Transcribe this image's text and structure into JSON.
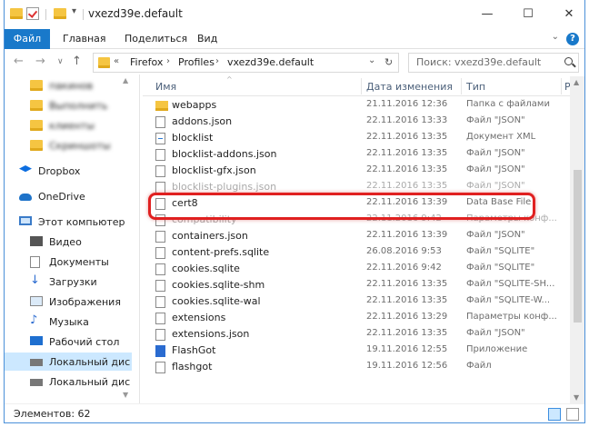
{
  "window": {
    "title": "vxezd39e.default"
  },
  "window_controls": {
    "minimize": "—",
    "maximize": "☐",
    "close": "✕"
  },
  "ribbon": {
    "tabs": [
      "Файл",
      "Главная",
      "Поделиться",
      "Вид"
    ],
    "help": "?"
  },
  "address": {
    "prefix": "«",
    "crumbs": [
      "Firefox",
      "Profiles",
      "vxezd39e.default"
    ],
    "search_placeholder": "Поиск: vxezd39e.default"
  },
  "navpane": {
    "quick_access": [
      "​пакинов",
      "Выполнить",
      "клиенты",
      "Скриншоты"
    ],
    "items": [
      {
        "label": "Dropbox",
        "icon": "dropbox-icon"
      },
      {
        "label": "OneDrive",
        "icon": "onedrive-icon"
      },
      {
        "label": "Этот компьютер",
        "icon": "computer-icon"
      },
      {
        "label": "Видео",
        "icon": "video-icon"
      },
      {
        "label": "Документы",
        "icon": "documents-icon"
      },
      {
        "label": "Загрузки",
        "icon": "downloads-icon"
      },
      {
        "label": "Изображения",
        "icon": "images-icon"
      },
      {
        "label": "Музыка",
        "icon": "music-icon"
      },
      {
        "label": "Рабочий стол",
        "icon": "desktop-icon"
      },
      {
        "label": "Локальный дис",
        "icon": "drive-icon"
      },
      {
        "label": "Локальный дис",
        "icon": "drive-icon"
      }
    ]
  },
  "columns": {
    "name": "Имя",
    "date": "Дата изменения",
    "type": "Тип",
    "size": "Р"
  },
  "files": [
    {
      "name": "webapps",
      "date": "21.11.2016 12:36",
      "type": "Папка с файлами",
      "kind": "folder"
    },
    {
      "name": "addons.json",
      "date": "22.11.2016 13:33",
      "type": "Файл \"JSON\"",
      "kind": "file"
    },
    {
      "name": "blocklist",
      "date": "22.11.2016 13:35",
      "type": "Документ XML",
      "kind": "xml"
    },
    {
      "name": "blocklist-addons.json",
      "date": "22.11.2016 13:35",
      "type": "Файл \"JSON\"",
      "kind": "file"
    },
    {
      "name": "blocklist-gfx.json",
      "date": "22.11.2016 13:35",
      "type": "Файл \"JSON\"",
      "kind": "file"
    },
    {
      "name": "blocklist-plugins.json",
      "date": "22.11.2016 13:35",
      "type": "Файл \"JSON\"",
      "kind": "file",
      "faded": true
    },
    {
      "name": "cert8",
      "date": "22.11.2016 13:39",
      "type": "Data Base File",
      "kind": "file"
    },
    {
      "name": "compatibility",
      "date": "22.11.2016 9:42",
      "type": "Параметры конф...",
      "kind": "file",
      "faded": true
    },
    {
      "name": "containers.json",
      "date": "22.11.2016 13:39",
      "type": "Файл \"JSON\"",
      "kind": "file"
    },
    {
      "name": "content-prefs.sqlite",
      "date": "26.08.2016 9:53",
      "type": "Файл \"SQLITE\"",
      "kind": "file"
    },
    {
      "name": "cookies.sqlite",
      "date": "22.11.2016 9:42",
      "type": "Файл \"SQLITE\"",
      "kind": "file"
    },
    {
      "name": "cookies.sqlite-shm",
      "date": "22.11.2016 13:35",
      "type": "Файл \"SQLITE-SH...",
      "kind": "file"
    },
    {
      "name": "cookies.sqlite-wal",
      "date": "22.11.2016 13:35",
      "type": "Файл \"SQLITE-W...",
      "kind": "file"
    },
    {
      "name": "extensions",
      "date": "22.11.2016 13:29",
      "type": "Параметры конф...",
      "kind": "file"
    },
    {
      "name": "extensions.json",
      "date": "22.11.2016 13:35",
      "type": "Файл \"JSON\"",
      "kind": "file"
    },
    {
      "name": "FlashGot",
      "date": "19.11.2016 12:55",
      "type": "Приложение",
      "kind": "exe"
    },
    {
      "name": "flashgot",
      "date": "19.11.2016 12:56",
      "type": "Файл",
      "kind": "file"
    }
  ],
  "status": {
    "items_count": "Элементов: 62"
  }
}
